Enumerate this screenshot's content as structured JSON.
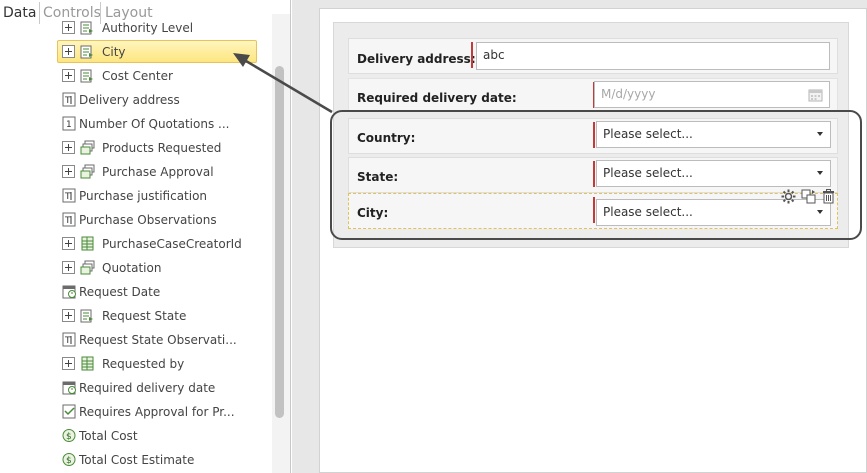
{
  "tabs": [
    {
      "label": "Data"
    },
    {
      "label": "Controls"
    },
    {
      "label": "Layout"
    }
  ],
  "tree": [
    {
      "label": "Authority Level",
      "icon": "entity-icon",
      "expandable": true
    },
    {
      "label": "City",
      "icon": "entity-icon",
      "expandable": true,
      "selected": true
    },
    {
      "label": "Cost Center",
      "icon": "entity-icon",
      "expandable": true
    },
    {
      "label": "Delivery address",
      "icon": "text-attribute-icon",
      "expandable": false
    },
    {
      "label": "Number Of Quotations ...",
      "icon": "number-attribute-icon",
      "expandable": false
    },
    {
      "label": "Products Requested",
      "icon": "collection-icon",
      "expandable": true
    },
    {
      "label": "Purchase Approval",
      "icon": "collection-icon",
      "expandable": true
    },
    {
      "label": "Purchase justification",
      "icon": "text-attribute-icon",
      "expandable": false
    },
    {
      "label": "Purchase Observations",
      "icon": "text-attribute-icon",
      "expandable": false
    },
    {
      "label": "PurchaseCaseCreatorId",
      "icon": "table-icon",
      "expandable": true
    },
    {
      "label": "Quotation",
      "icon": "collection-icon",
      "expandable": true
    },
    {
      "label": "Request Date",
      "icon": "date-attribute-icon",
      "expandable": false
    },
    {
      "label": "Request State",
      "icon": "entity-icon",
      "expandable": true
    },
    {
      "label": "Request State Observati...",
      "icon": "text-attribute-icon",
      "expandable": false
    },
    {
      "label": "Requested by",
      "icon": "table-icon",
      "expandable": true
    },
    {
      "label": "Required delivery date",
      "icon": "date-attribute-icon",
      "expandable": false
    },
    {
      "label": "Requires Approval for Pr...",
      "icon": "boolean-attribute-icon",
      "expandable": false
    },
    {
      "label": "Total Cost",
      "icon": "currency-attribute-icon",
      "expandable": false
    },
    {
      "label": "Total Cost Estimate",
      "icon": "currency-attribute-icon",
      "expandable": false
    }
  ],
  "form": {
    "delivery_address": {
      "label": "Delivery address:",
      "value": "abc"
    },
    "required_delivery_date": {
      "label": "Required delivery date:",
      "placeholder": "M/d/yyyy"
    },
    "country": {
      "label": "Country:",
      "value": "Please select..."
    },
    "state": {
      "label": "State:",
      "value": "Please select..."
    },
    "city": {
      "label": "City:",
      "value": "Please select..."
    }
  },
  "colors": {
    "required_marker": "#c23b3b",
    "selection_fill": "#fde67f",
    "selection_border": "#e8c25a",
    "callout": "#4a4a4a"
  }
}
